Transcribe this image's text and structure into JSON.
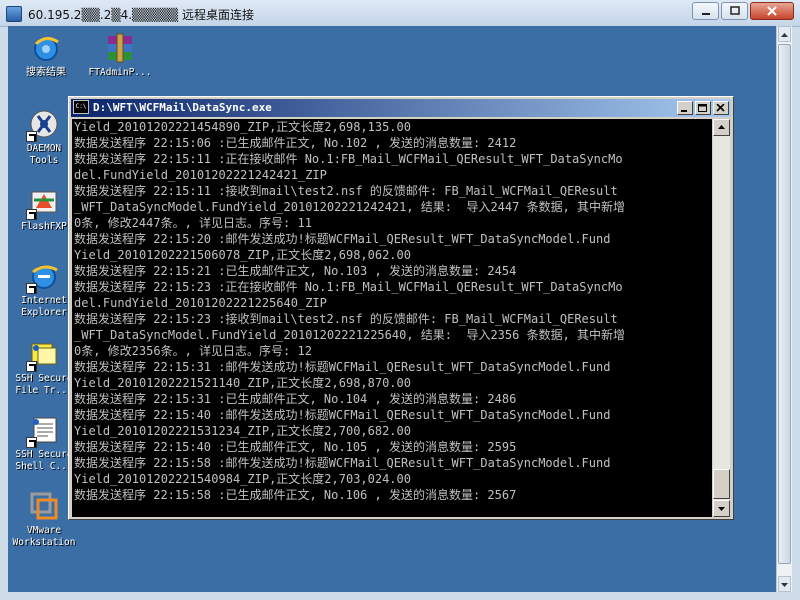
{
  "rdp_window": {
    "title": "60.195.2▒▒.2▒4.▒▒▒▒▒ 远程桌面连接",
    "controls": [
      "minimize",
      "maximize",
      "close"
    ],
    "icon": "remote-desktop-icon"
  },
  "desktop_icons": [
    {
      "label": "搜索结果",
      "icon": "ie-search-icon"
    },
    {
      "label": "FTAdminP...",
      "icon": "winrar-archive-icon"
    },
    {
      "label": "DAEMON Tools",
      "icon": "daemon-tools-icon"
    },
    {
      "label": "FlashFXP",
      "icon": "flashfxp-icon"
    },
    {
      "label": "Internet Explorer",
      "icon": "internet-explorer-icon"
    },
    {
      "label": "SSH Secure File Tr...",
      "icon": "ssh-file-transfer-icon"
    },
    {
      "label": "SSH Secure Shell C...",
      "icon": "ssh-shell-icon"
    },
    {
      "label": "VMware Workstation",
      "icon": "vmware-icon"
    }
  ],
  "console": {
    "title": "D:\\WFT\\WCFMail\\DataSync.exe",
    "icon_text": "C:\\",
    "lines": [
      "Yield_20101202221454890_ZIP,正文长度2,698,135.00",
      "数据发送程序 22:15:06 :已生成邮件正文, No.102 , 发送的消息数量: 2412",
      "数据发送程序 22:15:11 :正在接收邮件 No.1:FB_Mail_WCFMail_QEResult_WFT_DataSyncMo",
      "del.FundYield_20101202221242421_ZIP",
      "数据发送程序 22:15:11 :接收到mail\\test2.nsf 的反馈邮件: FB_Mail_WCFMail_QEResult",
      "_WFT_DataSyncModel.FundYield_20101202221242421, 结果:  导入2447 条数据, 其中新增",
      "0条, 修改2447条。, 详见日志。序号: 11",
      "数据发送程序 22:15:20 :邮件发送成功!标题WCFMail_QEResult_WFT_DataSyncModel.Fund",
      "Yield_20101202221506078_ZIP,正文长度2,698,062.00",
      "数据发送程序 22:15:21 :已生成邮件正文, No.103 , 发送的消息数量: 2454",
      "数据发送程序 22:15:23 :正在接收邮件 No.1:FB_Mail_WCFMail_QEResult_WFT_DataSyncMo",
      "del.FundYield_20101202221225640_ZIP",
      "数据发送程序 22:15:23 :接收到mail\\test2.nsf 的反馈邮件: FB_Mail_WCFMail_QEResult",
      "_WFT_DataSyncModel.FundYield_20101202221225640, 结果:  导入2356 条数据, 其中新增",
      "0条, 修改2356条。, 详见日志。序号: 12",
      "数据发送程序 22:15:31 :邮件发送成功!标题WCFMail_QEResult_WFT_DataSyncModel.Fund",
      "Yield_20101202221521140_ZIP,正文长度2,698,870.00",
      "数据发送程序 22:15:31 :已生成邮件正文, No.104 , 发送的消息数量: 2486",
      "数据发送程序 22:15:40 :邮件发送成功!标题WCFMail_QEResult_WFT_DataSyncModel.Fund",
      "Yield_20101202221531234_ZIP,正文长度2,700,682.00",
      "数据发送程序 22:15:40 :已生成邮件正文, No.105 , 发送的消息数量: 2595",
      "数据发送程序 22:15:58 :邮件发送成功!标题WCFMail_QEResult_WFT_DataSyncModel.Fund",
      "Yield_20101202221540984_ZIP,正文长度2,703,024.00",
      "数据发送程序 22:15:58 :已生成邮件正文, No.106 , 发送的消息数量: 2567"
    ]
  }
}
